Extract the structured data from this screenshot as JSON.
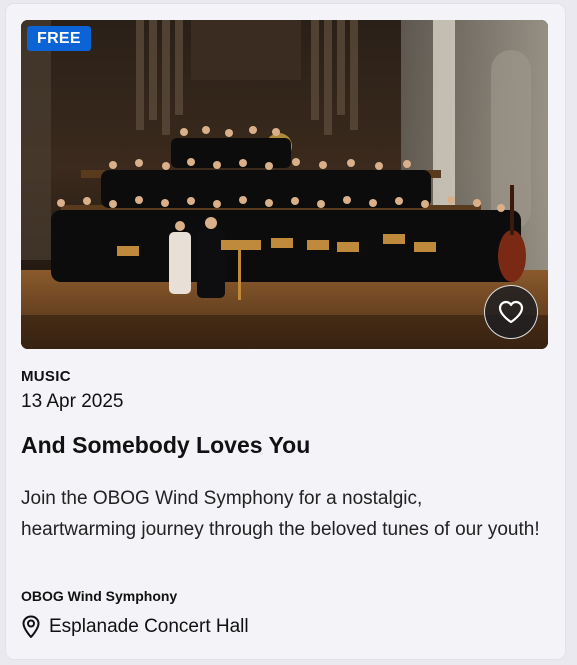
{
  "event": {
    "badge": "FREE",
    "category": "MUSIC",
    "date": "13 Apr 2025",
    "title": "And Somebody Loves You",
    "description": "Join the OBOG Wind Symphony for a nostalgic, heartwarming journey through the beloved tunes of our youth!",
    "organizer": "OBOG Wind Symphony",
    "venue": "Esplanade Concert Hall"
  },
  "icons": {
    "favorite": "heart-outline-icon",
    "location": "map-pin-icon"
  },
  "colors": {
    "badge_bg": "#0b63d6",
    "card_bg": "#f3f3f8",
    "text": "#111111"
  }
}
